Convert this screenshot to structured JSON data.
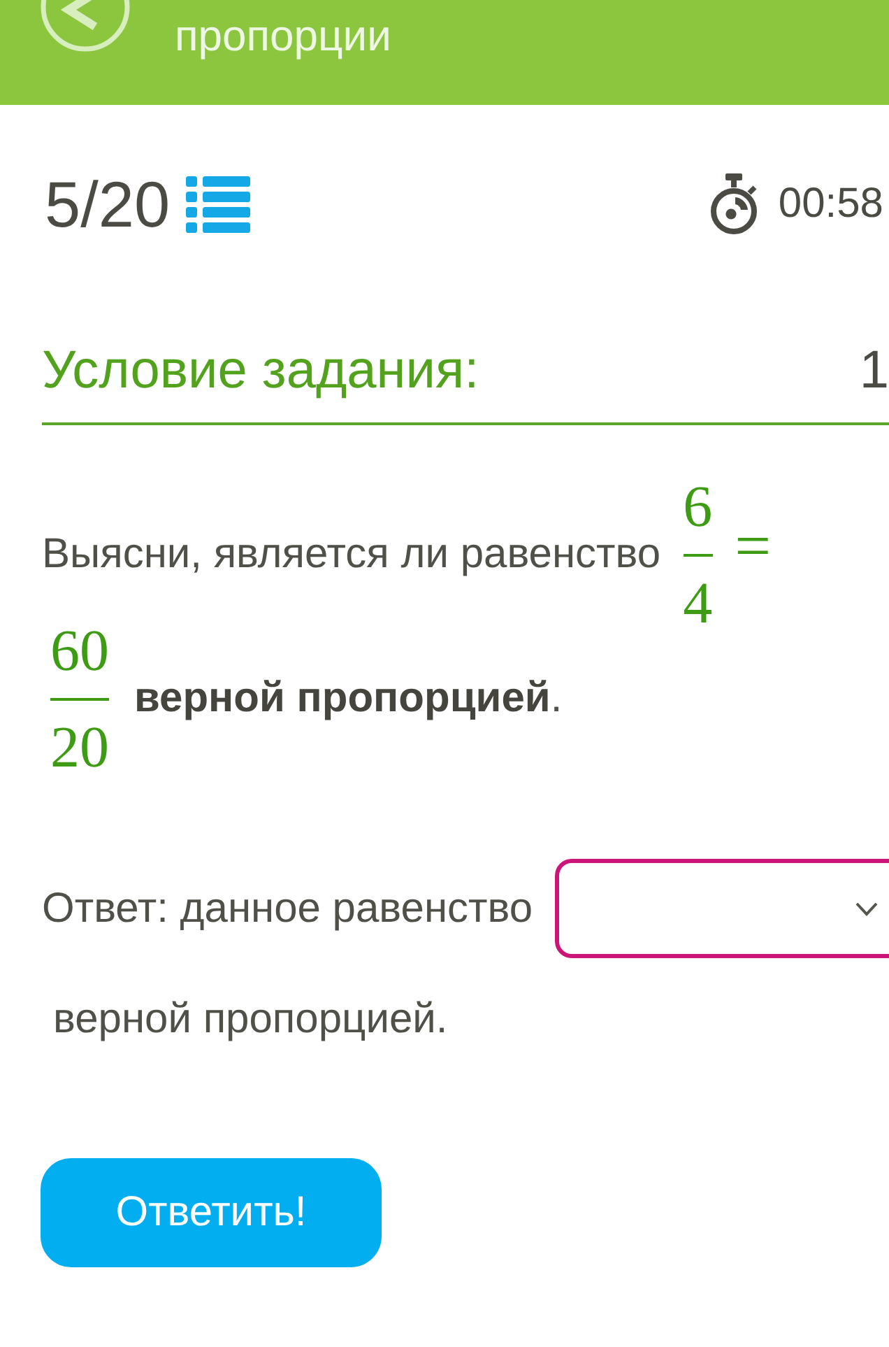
{
  "header": {
    "title": "пропорции"
  },
  "progress": {
    "counter": "5/20",
    "time": "00:58"
  },
  "task": {
    "heading": "Условие задания:",
    "column_2": "1"
  },
  "problem": {
    "text_before": "Выясни, является ли равенство",
    "left_fraction": {
      "numerator": "6",
      "denominator": "4"
    },
    "sign": "=",
    "right_fraction": {
      "numerator": "60",
      "denominator": "20"
    },
    "text_after": "**верной пропорцией**."
  },
  "answer": {
    "prefix": "Ответ: данное равенство",
    "suffix": "верной пропорцией."
  },
  "submit_button": {
    "label": "Ответить!"
  }
}
